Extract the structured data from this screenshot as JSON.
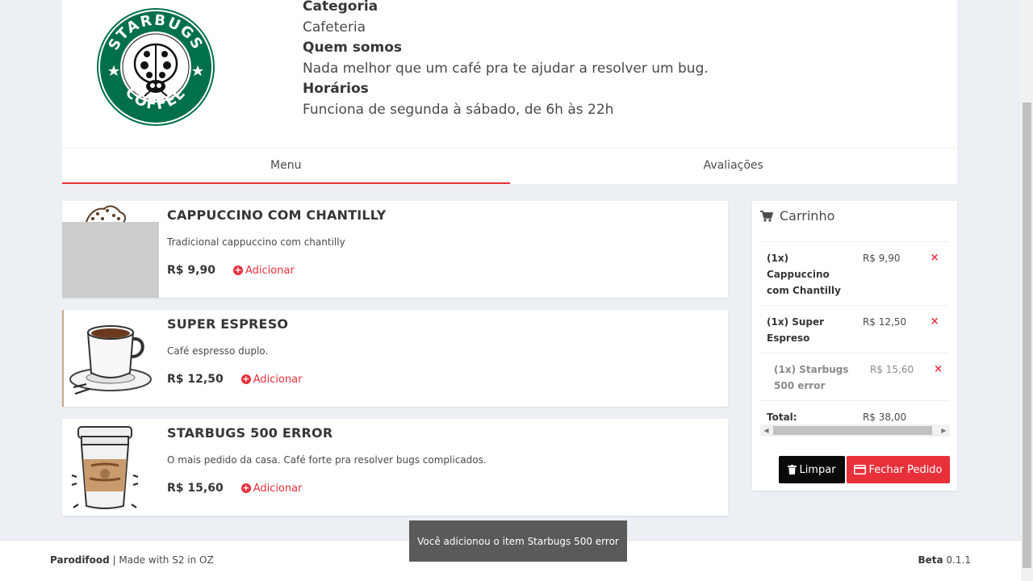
{
  "restaurant": {
    "logo_alt": "STARBUGS COFFEE",
    "logo_top_text": "STARBUGS",
    "logo_bottom_text": "COFFEE",
    "category_label": "Categoria",
    "category_value": "Cafeteria",
    "about_label": "Quem somos",
    "about_value": "Nada melhor que um café pra te ajudar a resolver um bug.",
    "hours_label": "Horários",
    "hours_value": "Funciona de segunda à sábado, de 6h às 22h"
  },
  "tabs": [
    {
      "label": "Menu",
      "active": true
    },
    {
      "label": "Avaliações",
      "active": false
    }
  ],
  "menu": [
    {
      "name": "CAPPUCCINO COM CHANTILLY",
      "description": "Tradicional cappuccino com chantilly",
      "price": "R$ 9,90",
      "add_label": "Adicionar"
    },
    {
      "name": "SUPER ESPRESO",
      "description": "Café espresso duplo.",
      "price": "R$ 12,50",
      "add_label": "Adicionar"
    },
    {
      "name": "STARBUGS 500 ERROR",
      "description": "O mais pedido da casa. Café forte pra resolver bugs complicados.",
      "price": "R$ 15,60",
      "add_label": "Adicionar"
    }
  ],
  "cart": {
    "title": "Carrinho",
    "items": [
      {
        "description": "(1x) Cappuccino com Chantilly",
        "value": "R$ 9,90",
        "remove": "×"
      },
      {
        "description": "(1x) Super Espreso",
        "value": "R$ 12,50",
        "remove": "×"
      },
      {
        "description": "(1x) Starbugs 500 error",
        "value": "R$ 15,60",
        "remove": "×"
      }
    ],
    "total_label": "Total:",
    "total_value": "R$ 38,00",
    "clear_label": "Limpar",
    "checkout_label": "Fechar Pedido"
  },
  "footer": {
    "brand": "Parodifood",
    "made_with": " | Made with S2 in OZ",
    "beta_label": "Beta",
    "version": " 0.1.1"
  },
  "toast": {
    "message": "Você adicionou o item Starbugs 500 error"
  },
  "colors": {
    "accent": "#e8303b",
    "logo_green": "#00704a"
  }
}
